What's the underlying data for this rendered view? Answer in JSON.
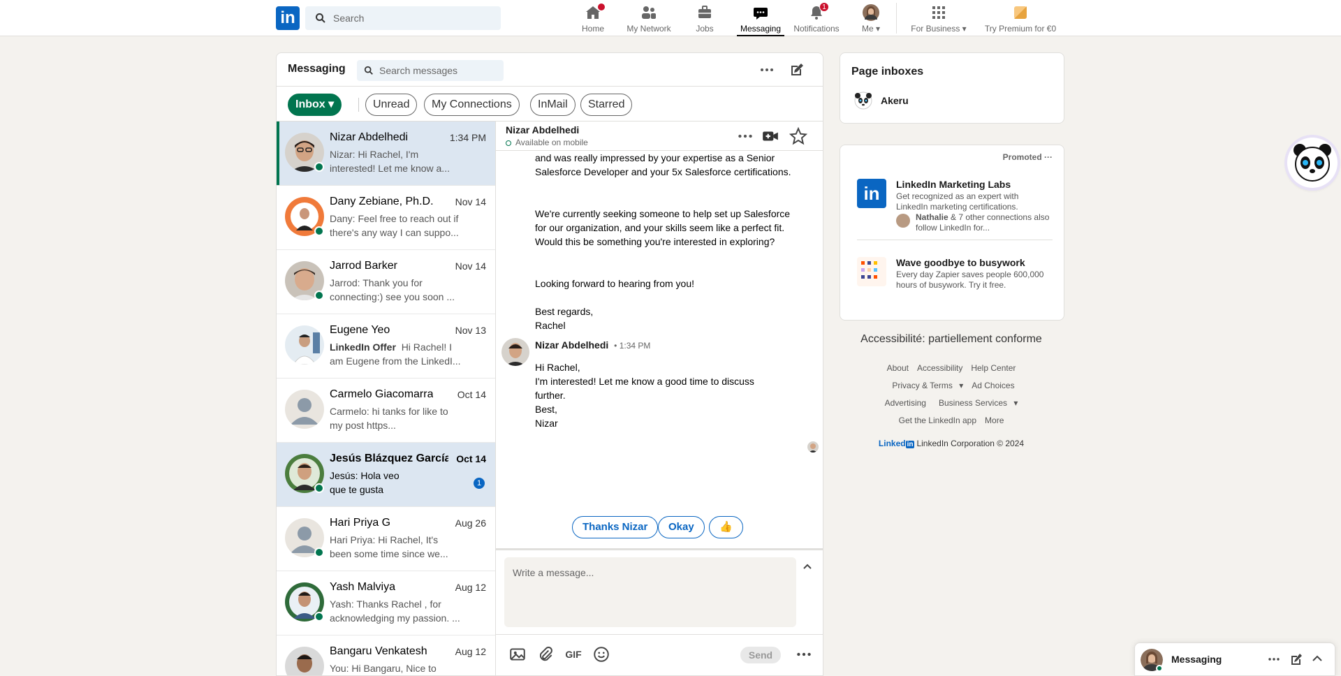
{
  "nav": {
    "search_placeholder": "Search",
    "home": "Home",
    "network": "My Network",
    "jobs": "Jobs",
    "messaging": "Messaging",
    "notifications": "Notifications",
    "notifications_badge": "1",
    "me": "Me",
    "business": "For Business",
    "premium": "Try Premium for €0"
  },
  "messaging": {
    "title": "Messaging",
    "search_placeholder": "Search messages",
    "filters": {
      "inbox": "Inbox",
      "unread": "Unread",
      "connections": "My Connections",
      "inmail": "InMail",
      "starred": "Starred"
    },
    "conversations": [
      {
        "name": "Nizar Abdelhedi",
        "date": "1:34 PM",
        "snippet": "Nizar: Hi Rachel, I'm interested! Let me know a..."
      },
      {
        "name": "Dany Zebiane, Ph.D.",
        "date": "Nov 14",
        "snippet": "Dany: Feel free to reach out if there's any way I can suppo..."
      },
      {
        "name": "Jarrod Barker",
        "date": "Nov 14",
        "snippet": "Jarrod: Thank you for connecting:) see you soon ..."
      },
      {
        "name": "Eugene Yeo",
        "date": "Nov 13",
        "tag": "LinkedIn Offer",
        "snippet": "Hi Rachel! I am Eugene from the LinkedI..."
      },
      {
        "name": "Carmelo Giacomarra",
        "date": "Oct 14",
        "snippet": "Carmelo: hi tanks for like to my post https..."
      },
      {
        "name": "Jesús Blázquez García",
        "date": "Oct 14",
        "snippet": "Jesús: Hola veo que te gusta",
        "unread": "1"
      },
      {
        "name": "Hari Priya G",
        "date": "Aug 26",
        "snippet": "Hari Priya: Hi Rachel, It's been some time since we..."
      },
      {
        "name": "Yash Malviya",
        "date": "Aug 12",
        "snippet": "Yash: Thanks Rachel , for acknowledging my passion. ..."
      },
      {
        "name": "Bangaru Venkatesh",
        "date": "Aug 12",
        "snippet": "You: Hi Bangaru, Nice to"
      }
    ],
    "thread": {
      "name": "Nizar Abdelhedi",
      "status": "Available on mobile",
      "prev_lines": [
        "and was really impressed by your expertise as a Senior Salesforce Developer and your 5x Salesforce certifications.",
        "We're currently seeking someone to help set up Salesforce for our organization, and your skills seem like a perfect fit. Would this be something you're interested in exploring?",
        "Looking forward to hearing from you!",
        "Best regards,",
        "Rachel"
      ],
      "sender": "Nizar Abdelhedi",
      "time": "• 1:34 PM",
      "reply_lines": [
        "Hi Rachel,",
        "I'm interested! Let me know a good time to discuss further.",
        "Best,",
        "Nizar"
      ],
      "quick_replies": [
        "Thanks Nizar",
        "Okay",
        "👍"
      ],
      "compose_placeholder": "Write a message...",
      "gif": "GIF",
      "send": "Send"
    }
  },
  "page_inboxes": {
    "title": "Page inboxes",
    "item": "Akeru"
  },
  "promo": {
    "label": "Promoted",
    "ads": [
      {
        "title": "LinkedIn Marketing Labs",
        "desc": "Get recognized as an expert with LinkedIn marketing certifications.",
        "social_name": "Nathalie",
        "social_rest": " & 7 other connections also follow LinkedIn for..."
      },
      {
        "title": "Wave goodbye to busywork",
        "desc": "Every day Zapier saves people 600,000 hours of busywork. Try it free."
      }
    ]
  },
  "footer": {
    "accessibility": "Accessibilité: partiellement conforme",
    "links": [
      "About",
      "Accessibility",
      "Help Center",
      "Privacy & Terms",
      "Ad Choices",
      "Advertising",
      "Business Services",
      "Get the LinkedIn app",
      "More"
    ],
    "brand": "Linked",
    "brand_in": "in",
    "copyright": "LinkedIn Corporation © 2024"
  },
  "mini": {
    "title": "Messaging"
  },
  "colors": {
    "brand": "#0a66c2",
    "accent_green": "#01754f",
    "badge_red": "#cb112d"
  }
}
